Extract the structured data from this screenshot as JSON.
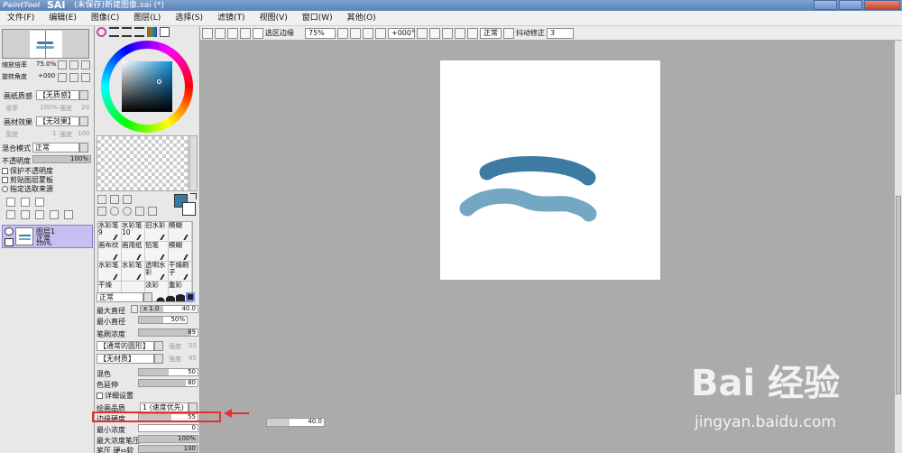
{
  "titlebar": {
    "logo": "PaintTool",
    "brand": "SAI",
    "title": "(未保存)新建图像.sai (*)"
  },
  "menu": [
    "文件(F)",
    "编辑(E)",
    "图像(C)",
    "图层(L)",
    "选择(S)",
    "滤镜(T)",
    "视图(V)",
    "窗口(W)",
    "其他(O)"
  ],
  "navigator": {
    "zoom_label": "缩放倍率",
    "zoom_value": "75.0%",
    "rotate_label": "旋转角度",
    "rotate_value": "+000"
  },
  "paper_texture": {
    "label": "画纸质感",
    "value": "【无质感】",
    "sub1": "倍率",
    "sub1_val": "100%",
    "sub2": "强度",
    "sub2_val": "20"
  },
  "material_effect": {
    "label": "画材效果",
    "value": "【无效果】",
    "sub1": "宽度",
    "sub1_val": "1",
    "sub2": "强度",
    "sub2_val": "100"
  },
  "blend": {
    "label": "混合模式",
    "value": "正常"
  },
  "opacity": {
    "label": "不透明度",
    "value": "100%",
    "level": 1.0
  },
  "layer_options": [
    "保护不透明度",
    "剪贴图层蒙板",
    "指定选取来源"
  ],
  "layer": {
    "name": "图层1",
    "mode": "正常",
    "opacity": "100%"
  },
  "brushes": [
    [
      "水彩笔9",
      "水彩笔10",
      "旧水彩",
      "模糊"
    ],
    [
      "画布纹",
      "画用纸",
      "铅笔",
      "模糊"
    ],
    [
      "水彩笔",
      "水彩笔",
      "透明水彩",
      "干燥刷子"
    ],
    [
      "干燥",
      "",
      "淡彩",
      "重彩"
    ]
  ],
  "brush_settings": {
    "mode": "正常",
    "max_diameter": {
      "label": "最大直径",
      "mult": "x 1.0",
      "value": "40.0",
      "level": 0.4
    },
    "min_diameter": {
      "label": "最小直径",
      "value": "50%",
      "level": 0.5
    },
    "density": {
      "label": "笔刷浓度",
      "value": "89",
      "level": 0.89
    },
    "shape": {
      "value": "【通常的圆形】",
      "strength_label": "强度",
      "strength_value": "50"
    },
    "texture": {
      "value": "【无材质】",
      "strength_label": "强度",
      "strength_value": "95"
    },
    "blending": {
      "label": "混色",
      "value": "50",
      "level": 0.5
    },
    "dilution": {
      "label": "色延伸",
      "value": "80",
      "level": 0.8
    },
    "details": "详细设置",
    "quality": {
      "label": "绘画品质",
      "value": "1 (速度优先)"
    },
    "edge_hardness": {
      "label": "边缘硬度",
      "value": "55",
      "level": 0.55
    },
    "min_density": {
      "label": "最小浓度",
      "value": "0",
      "level": 0.0
    },
    "max_pressure": {
      "label": "最大浓度笔压",
      "value": "100%",
      "level": 1.0
    },
    "pressure": {
      "label": "笔压 硬⇔软",
      "value": "100",
      "level": 1.0
    }
  },
  "toolbar": {
    "selection_edge": "选区边缘",
    "zoom": "75%",
    "angle": "+000°",
    "mode": "正常",
    "stabilizer_label": "抖动修正",
    "stabilizer_value": "3"
  },
  "floating_value": {
    "value": "40.0",
    "level": 0.4
  },
  "watermark": {
    "line1": "Bai 经验",
    "line2": "jingyan.baidu.com"
  },
  "colors": {
    "primary": "#3b7aa0",
    "stroke1": "#3e7ba3",
    "stroke2": "#73a7c4",
    "highlight": "#e53030"
  }
}
